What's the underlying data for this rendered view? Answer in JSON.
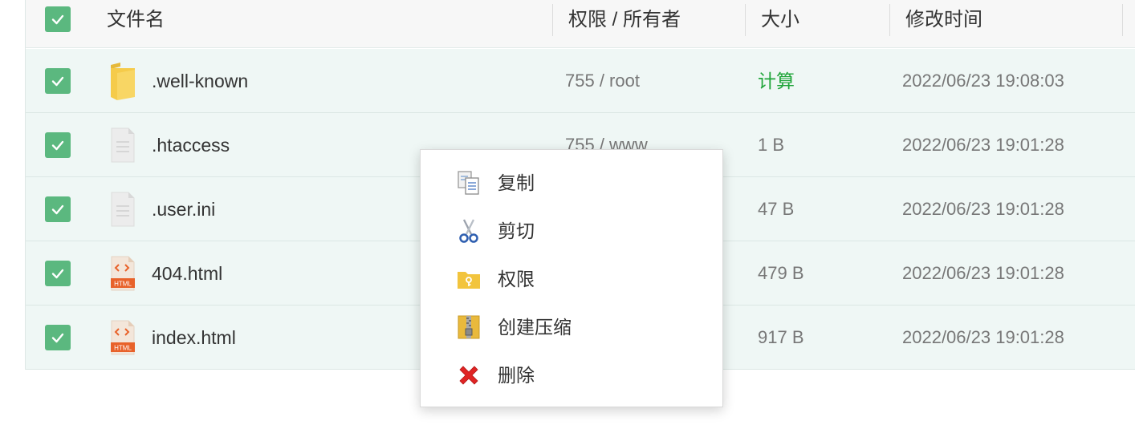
{
  "header": {
    "name": "文件名",
    "perm": "权限 / 所有者",
    "size": "大小",
    "mtime": "修改时间"
  },
  "files": [
    {
      "name": ".well-known",
      "perm": "755 / root",
      "size": "计算",
      "mtime": "2022/06/23 19:08:03",
      "type": "folder-icon"
    },
    {
      "name": ".htaccess",
      "perm": "755 / www",
      "size": "1 B",
      "mtime": "2022/06/23 19:01:28",
      "type": "text-file-icon"
    },
    {
      "name": ".user.ini",
      "perm": "",
      "size": "47 B",
      "mtime": "2022/06/23 19:01:28",
      "type": "text-file-icon"
    },
    {
      "name": "404.html",
      "perm": "",
      "size": "479 B",
      "mtime": "2022/06/23 19:01:28",
      "type": "html-file-icon"
    },
    {
      "name": "index.html",
      "perm": "",
      "size": "917 B",
      "mtime": "2022/06/23 19:01:28",
      "type": "html-file-icon"
    }
  ],
  "html_badge": "HTML",
  "context_menu": {
    "items": [
      {
        "label": "复制",
        "icon": "copy-icon"
      },
      {
        "label": "剪切",
        "icon": "scissors-icon"
      },
      {
        "label": "权限",
        "icon": "permission-folder-icon"
      },
      {
        "label": "创建压缩",
        "icon": "zip-archive-icon"
      },
      {
        "label": "删除",
        "icon": "delete-icon"
      }
    ]
  },
  "colors": {
    "checkbox": "#5bb87f",
    "row_bg": "#eff7f5",
    "header_bg": "#f7f7f7",
    "calc_link": "#20a53a",
    "delete_red": "#e02424"
  }
}
